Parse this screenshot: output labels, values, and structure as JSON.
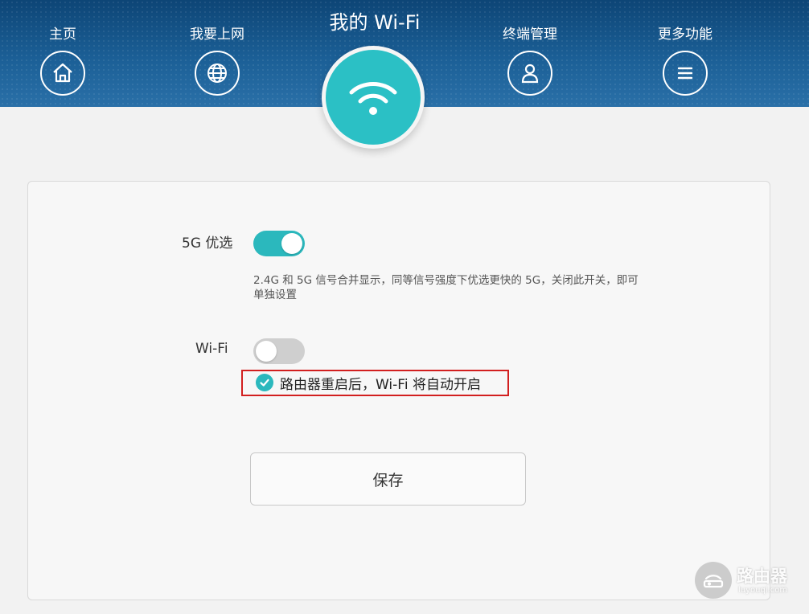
{
  "nav": {
    "items": [
      {
        "label": "主页",
        "icon": "home-icon"
      },
      {
        "label": "我要上网",
        "icon": "globe-icon"
      },
      {
        "label": "终端管理",
        "icon": "user-icon"
      },
      {
        "label": "更多功能",
        "icon": "menu-icon"
      }
    ],
    "active": {
      "label": "我的 Wi-Fi",
      "icon": "wifi-icon"
    }
  },
  "settings": {
    "pref5g": {
      "label": "5G 优选",
      "enabled": true,
      "description": "2.4G 和 5G 信号合并显示，同等信号强度下优选更快的 5G，关闭此开关，即可单独设置"
    },
    "wifi": {
      "label": "Wi-Fi",
      "enabled": false,
      "auto_on_label": "路由器重启后，Wi-Fi 将自动开启",
      "auto_on_checked": true
    }
  },
  "save_label": "保存",
  "watermark": {
    "title": "路由器",
    "subtitle": "luyouqi.com"
  },
  "colors": {
    "accent": "#2bb8bd",
    "header": "#1b5f96",
    "highlight": "#d21f1f"
  }
}
